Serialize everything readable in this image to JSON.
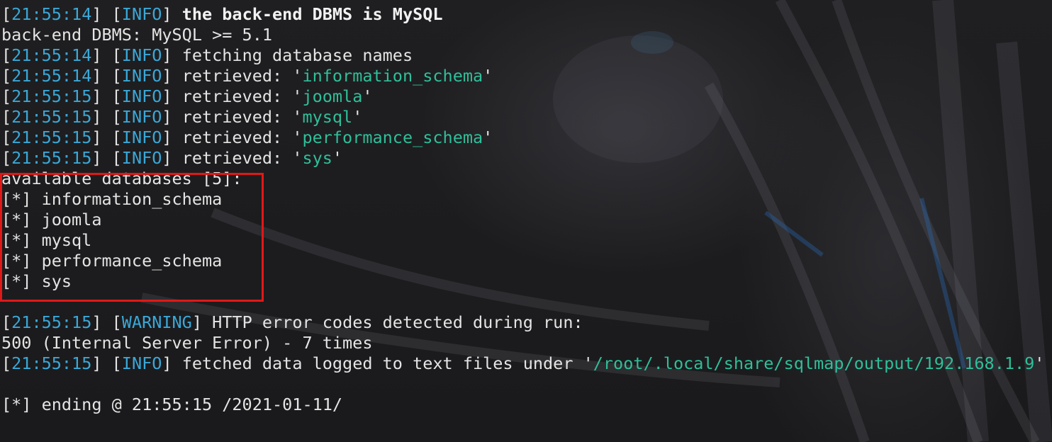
{
  "terminal": {
    "lines": [
      {
        "ts": "21:55:14",
        "tag": "INFO",
        "text": "the back-end DBMS is MySQL",
        "bold": true
      },
      {
        "plain": "back-end DBMS: MySQL >= 5.1"
      },
      {
        "ts": "21:55:14",
        "tag": "INFO",
        "text": "fetching database names"
      },
      {
        "ts": "21:55:14",
        "tag": "INFO",
        "text": "retrieved: '",
        "value": "information_schema",
        "suffix": "'"
      },
      {
        "ts": "21:55:15",
        "tag": "INFO",
        "text": "retrieved: '",
        "value": "joomla",
        "suffix": "'"
      },
      {
        "ts": "21:55:15",
        "tag": "INFO",
        "text": "retrieved: '",
        "value": "mysql",
        "suffix": "'"
      },
      {
        "ts": "21:55:15",
        "tag": "INFO",
        "text": "retrieved: '",
        "value": "performance_schema",
        "suffix": "'"
      },
      {
        "ts": "21:55:15",
        "tag": "INFO",
        "text": "retrieved: '",
        "value": "sys",
        "suffix": "'"
      },
      {
        "plain": "available databases [5]:"
      },
      {
        "plain": "[*] information_schema"
      },
      {
        "plain": "[*] joomla"
      },
      {
        "plain": "[*] mysql"
      },
      {
        "plain": "[*] performance_schema"
      },
      {
        "plain": "[*] sys"
      },
      {
        "plain": ""
      },
      {
        "ts": "21:55:15",
        "tag": "WARNING",
        "text": "HTTP error codes detected during run:"
      },
      {
        "plain": "500 (Internal Server Error) - 7 times"
      },
      {
        "ts": "21:55:15",
        "tag": "INFO",
        "text": "fetched data logged to text files under '",
        "value": "/root/.local/share/sqlmap/output/192.168.1.9",
        "suffix": "'"
      },
      {
        "plain": ""
      },
      {
        "plain": "[*] ending @ 21:55:15 /2021-01-11/"
      }
    ]
  },
  "colors": {
    "timestamp": "#3aa8d8",
    "value": "#2fbf9a",
    "text": "#e4e4e4",
    "highlight_box": "#e01818"
  }
}
